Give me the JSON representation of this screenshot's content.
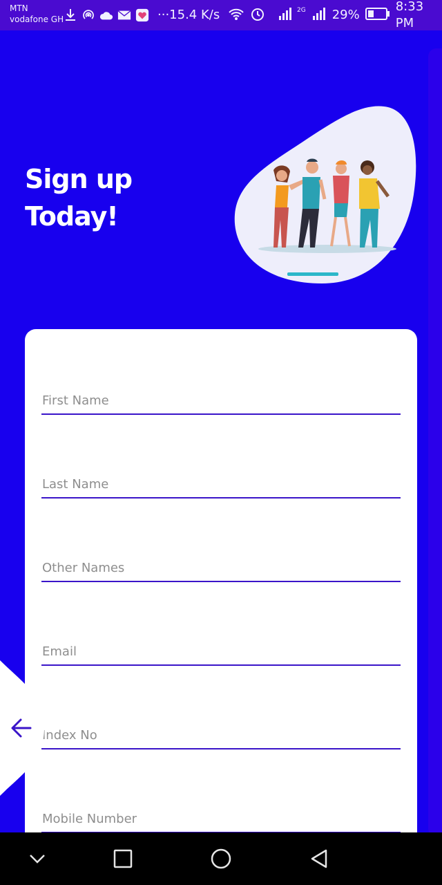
{
  "status_bar": {
    "carrier_primary": "MTN",
    "carrier_secondary": "vodafone GH",
    "net_speed": "···15.4 K/s",
    "network_label": "2G",
    "battery": "29%",
    "time": "8:33 PM",
    "icons": [
      "download-icon",
      "hotspot-icon",
      "cloud-icon",
      "mail-icon",
      "app-icon",
      "wifi-icon",
      "alarm-icon",
      "signal-icon",
      "battery-icon"
    ]
  },
  "header": {
    "title_line1": "Sign up",
    "title_line2": "Today!"
  },
  "form": {
    "fields": [
      {
        "placeholder": "First Name"
      },
      {
        "placeholder": "Last Name"
      },
      {
        "placeholder": "Other Names"
      },
      {
        "placeholder": "Email"
      },
      {
        "placeholder": "Index No"
      },
      {
        "placeholder": "Mobile Number"
      }
    ]
  },
  "colors": {
    "background": "#1800ee",
    "status_bar": "#4a0bd0",
    "accent": "#3a14c9",
    "card": "#ffffff"
  }
}
